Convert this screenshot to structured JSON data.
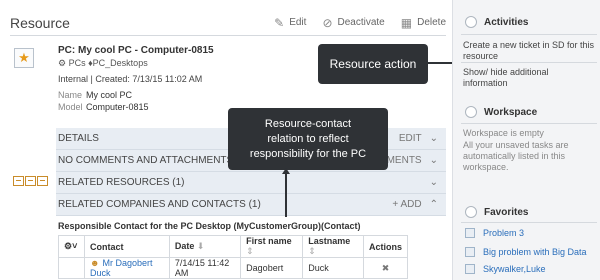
{
  "header": {
    "title": "Resource",
    "edit_label": "Edit",
    "deactivate_label": "Deactivate",
    "delete_label": "Delete"
  },
  "summary": {
    "title": "PC: My cool PC - Computer-0815",
    "categories": "PCs ♦PC_Desktops",
    "meta": "Internal | Created: 7/13/15 11:02 AM",
    "name_key": "Name",
    "name_value": "My cool PC",
    "model_key": "Model",
    "model_value": "Computer-0815"
  },
  "sections": {
    "details": "DETAILS",
    "details_edit": "Edit",
    "comments": "NO COMMENTS AND ATTACHMENTS",
    "comments_right": "chments",
    "related_resources": "RELATED RESOURCES (1)",
    "related_contacts": "RELATED COMPANIES AND CONTACTS (1)",
    "add_label": "+ Add"
  },
  "contacts": {
    "caption": "Responsible Contact for the PC Desktop (MyCustomerGroup)(Contact)",
    "columns": [
      "Contact",
      "Date",
      "First name",
      "Lastname",
      "Actions"
    ],
    "rows": [
      {
        "contact": "Mr Dagobert Duck",
        "date": "7/14/15 11:42 AM",
        "first": "Dagobert",
        "last": "Duck"
      }
    ]
  },
  "tooltips": {
    "action": "Resource action",
    "relation_line1": "Resource-contact",
    "relation_line2": "relation to reflect",
    "relation_line3": "responsibility for the PC"
  },
  "right": {
    "activities_title": "Activities",
    "activities_text1": "Create a new ticket in SD for this resource",
    "activities_text2": "Show/ hide additional information",
    "workspace_title": "Workspace",
    "workspace_text": "Workspace is empty",
    "workspace_hint": "All your unsaved tasks are automatically listed in this workspace.",
    "favorites_title": "Favorites",
    "favorites": [
      "Problem 3",
      "Big problem with Big Data",
      "Skywalker,Luke"
    ]
  }
}
